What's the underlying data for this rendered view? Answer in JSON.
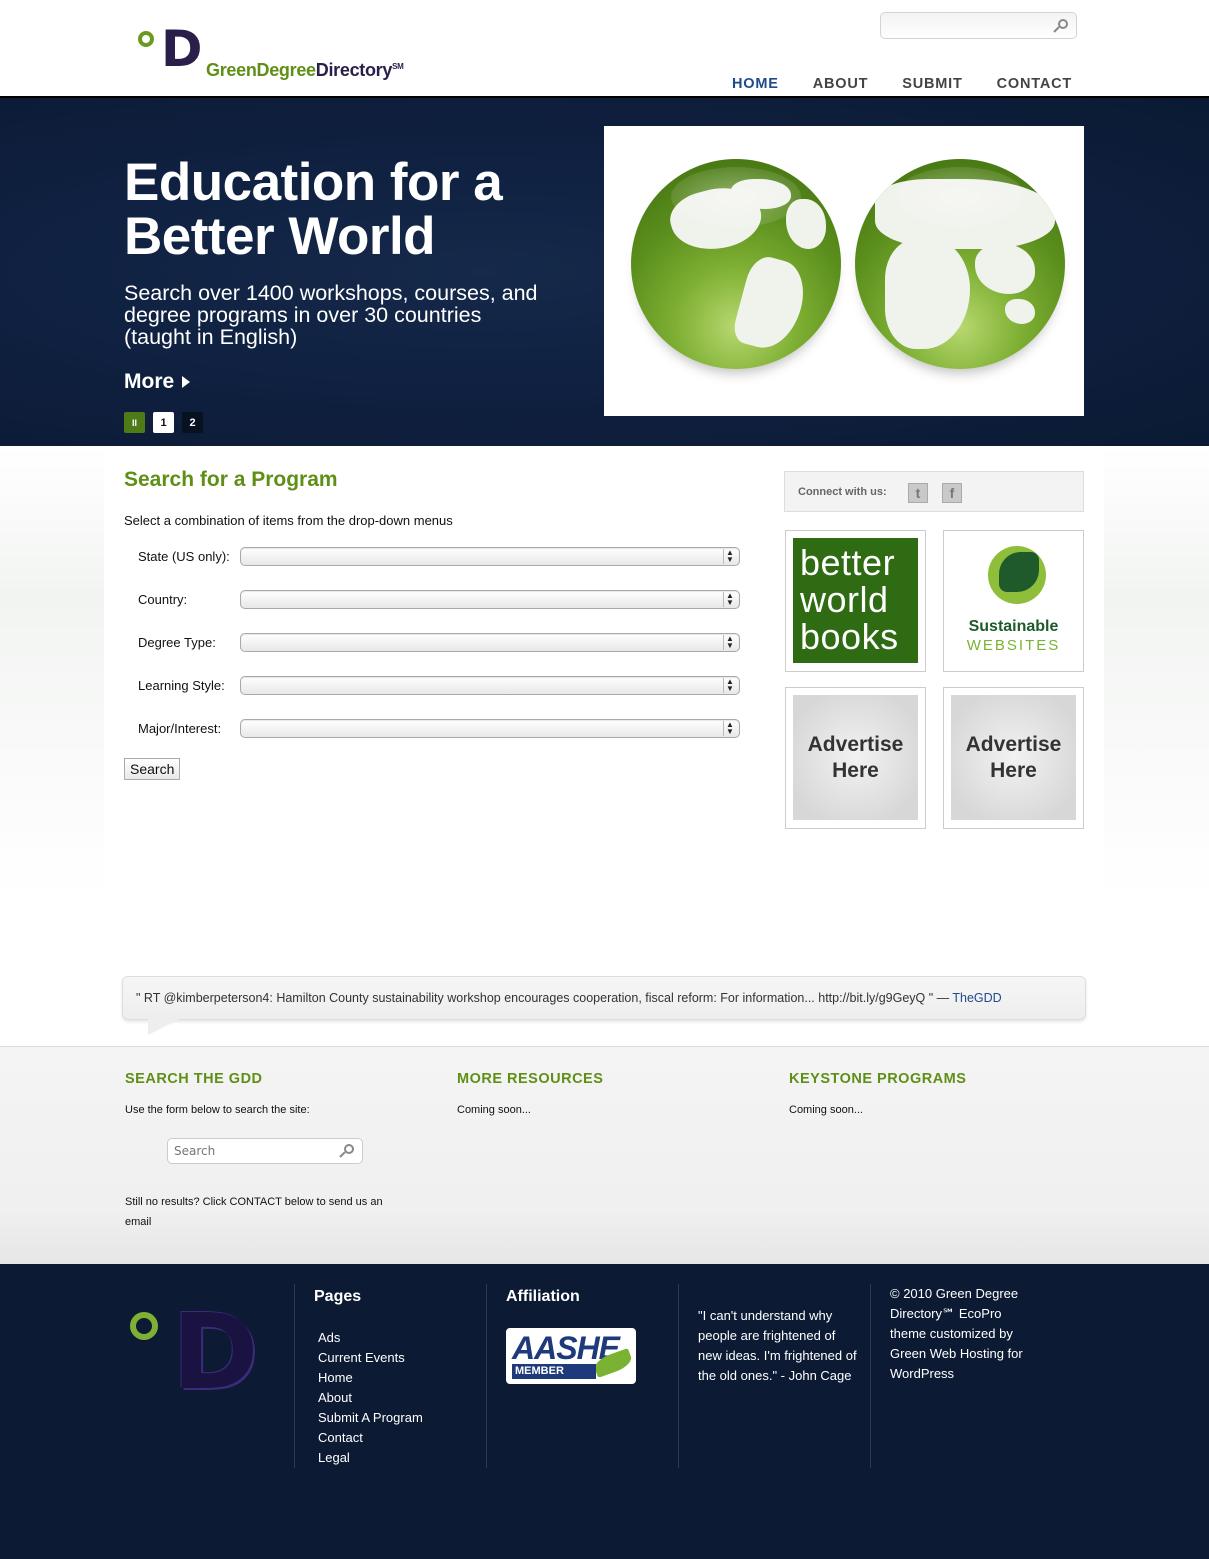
{
  "site": {
    "logo_name_1": "GreenDegree",
    "logo_name_2": "Directory",
    "logo_sm": "SM",
    "logo_letter": "D"
  },
  "header": {
    "search_placeholder": "",
    "nav": [
      "HOME",
      "ABOUT",
      "SUBMIT",
      "CONTACT"
    ],
    "active_nav": "HOME"
  },
  "hero": {
    "title": "Education for a Better World",
    "subtitle": "Search over 1400 workshops, courses, and degree programs in over 30 countries (taught in English)",
    "more_label": "More",
    "controls": [
      "II",
      "1",
      "2"
    ]
  },
  "search_program": {
    "title": "Search for a Program",
    "intro": "Select a combination of items from the drop-down menus",
    "fields": [
      {
        "label": "State (US only):",
        "value": ""
      },
      {
        "label": "Country:",
        "value": ""
      },
      {
        "label": "Degree Type:",
        "value": ""
      },
      {
        "label": "Learning Style:",
        "value": ""
      },
      {
        "label": "Major/Interest:",
        "value": ""
      }
    ],
    "search_button": "Search"
  },
  "sidebar": {
    "connect_label": "Connect with us:",
    "twitter_glyph": "t",
    "facebook_glyph": "f",
    "ads": {
      "bwb": [
        "better",
        "world",
        "books"
      ],
      "sw_line1": "Sustainable",
      "sw_line2": "WEBSITES",
      "advertise_line1": "Advertise",
      "advertise_line2": "Here"
    }
  },
  "tweet": {
    "text": "\" RT @kimberpeterson4: Hamilton County sustainability workshop encourages cooperation, fiscal reform: For information... http://bit.ly/g9GeyQ \" —",
    "author": "TheGDD"
  },
  "widgets": {
    "search": {
      "title": "SEARCH THE GDD",
      "text": "Use the form below to search the site:",
      "placeholder": "Search",
      "no_results": "Still no results? Click CONTACT below to send us an email"
    },
    "resources": {
      "title": "MORE RESOURCES",
      "text": "Coming soon..."
    },
    "keystone": {
      "title": "KEYSTONE PROGRAMS",
      "text": "Coming soon..."
    }
  },
  "footer": {
    "pages_title": "Pages",
    "pages": [
      "Ads",
      "Current Events",
      "Home",
      "About",
      "Submit A Program",
      "Contact",
      "Legal"
    ],
    "affiliation_title": "Affiliation",
    "aashe_word": "AASHE",
    "aashe_member": "MEMBER",
    "quote": "\"I can't understand why people are frightened of new ideas. I'm frightened of the old ones.\" - John Cage",
    "copyright": "© 2010 Green Degree Directory℠ EcoPro theme customized by Green Web Hosting for WordPress"
  },
  "colors": {
    "brand_green": "#5f8f16",
    "navy": "#0c1a34",
    "nav_active": "#1f4a8a"
  }
}
